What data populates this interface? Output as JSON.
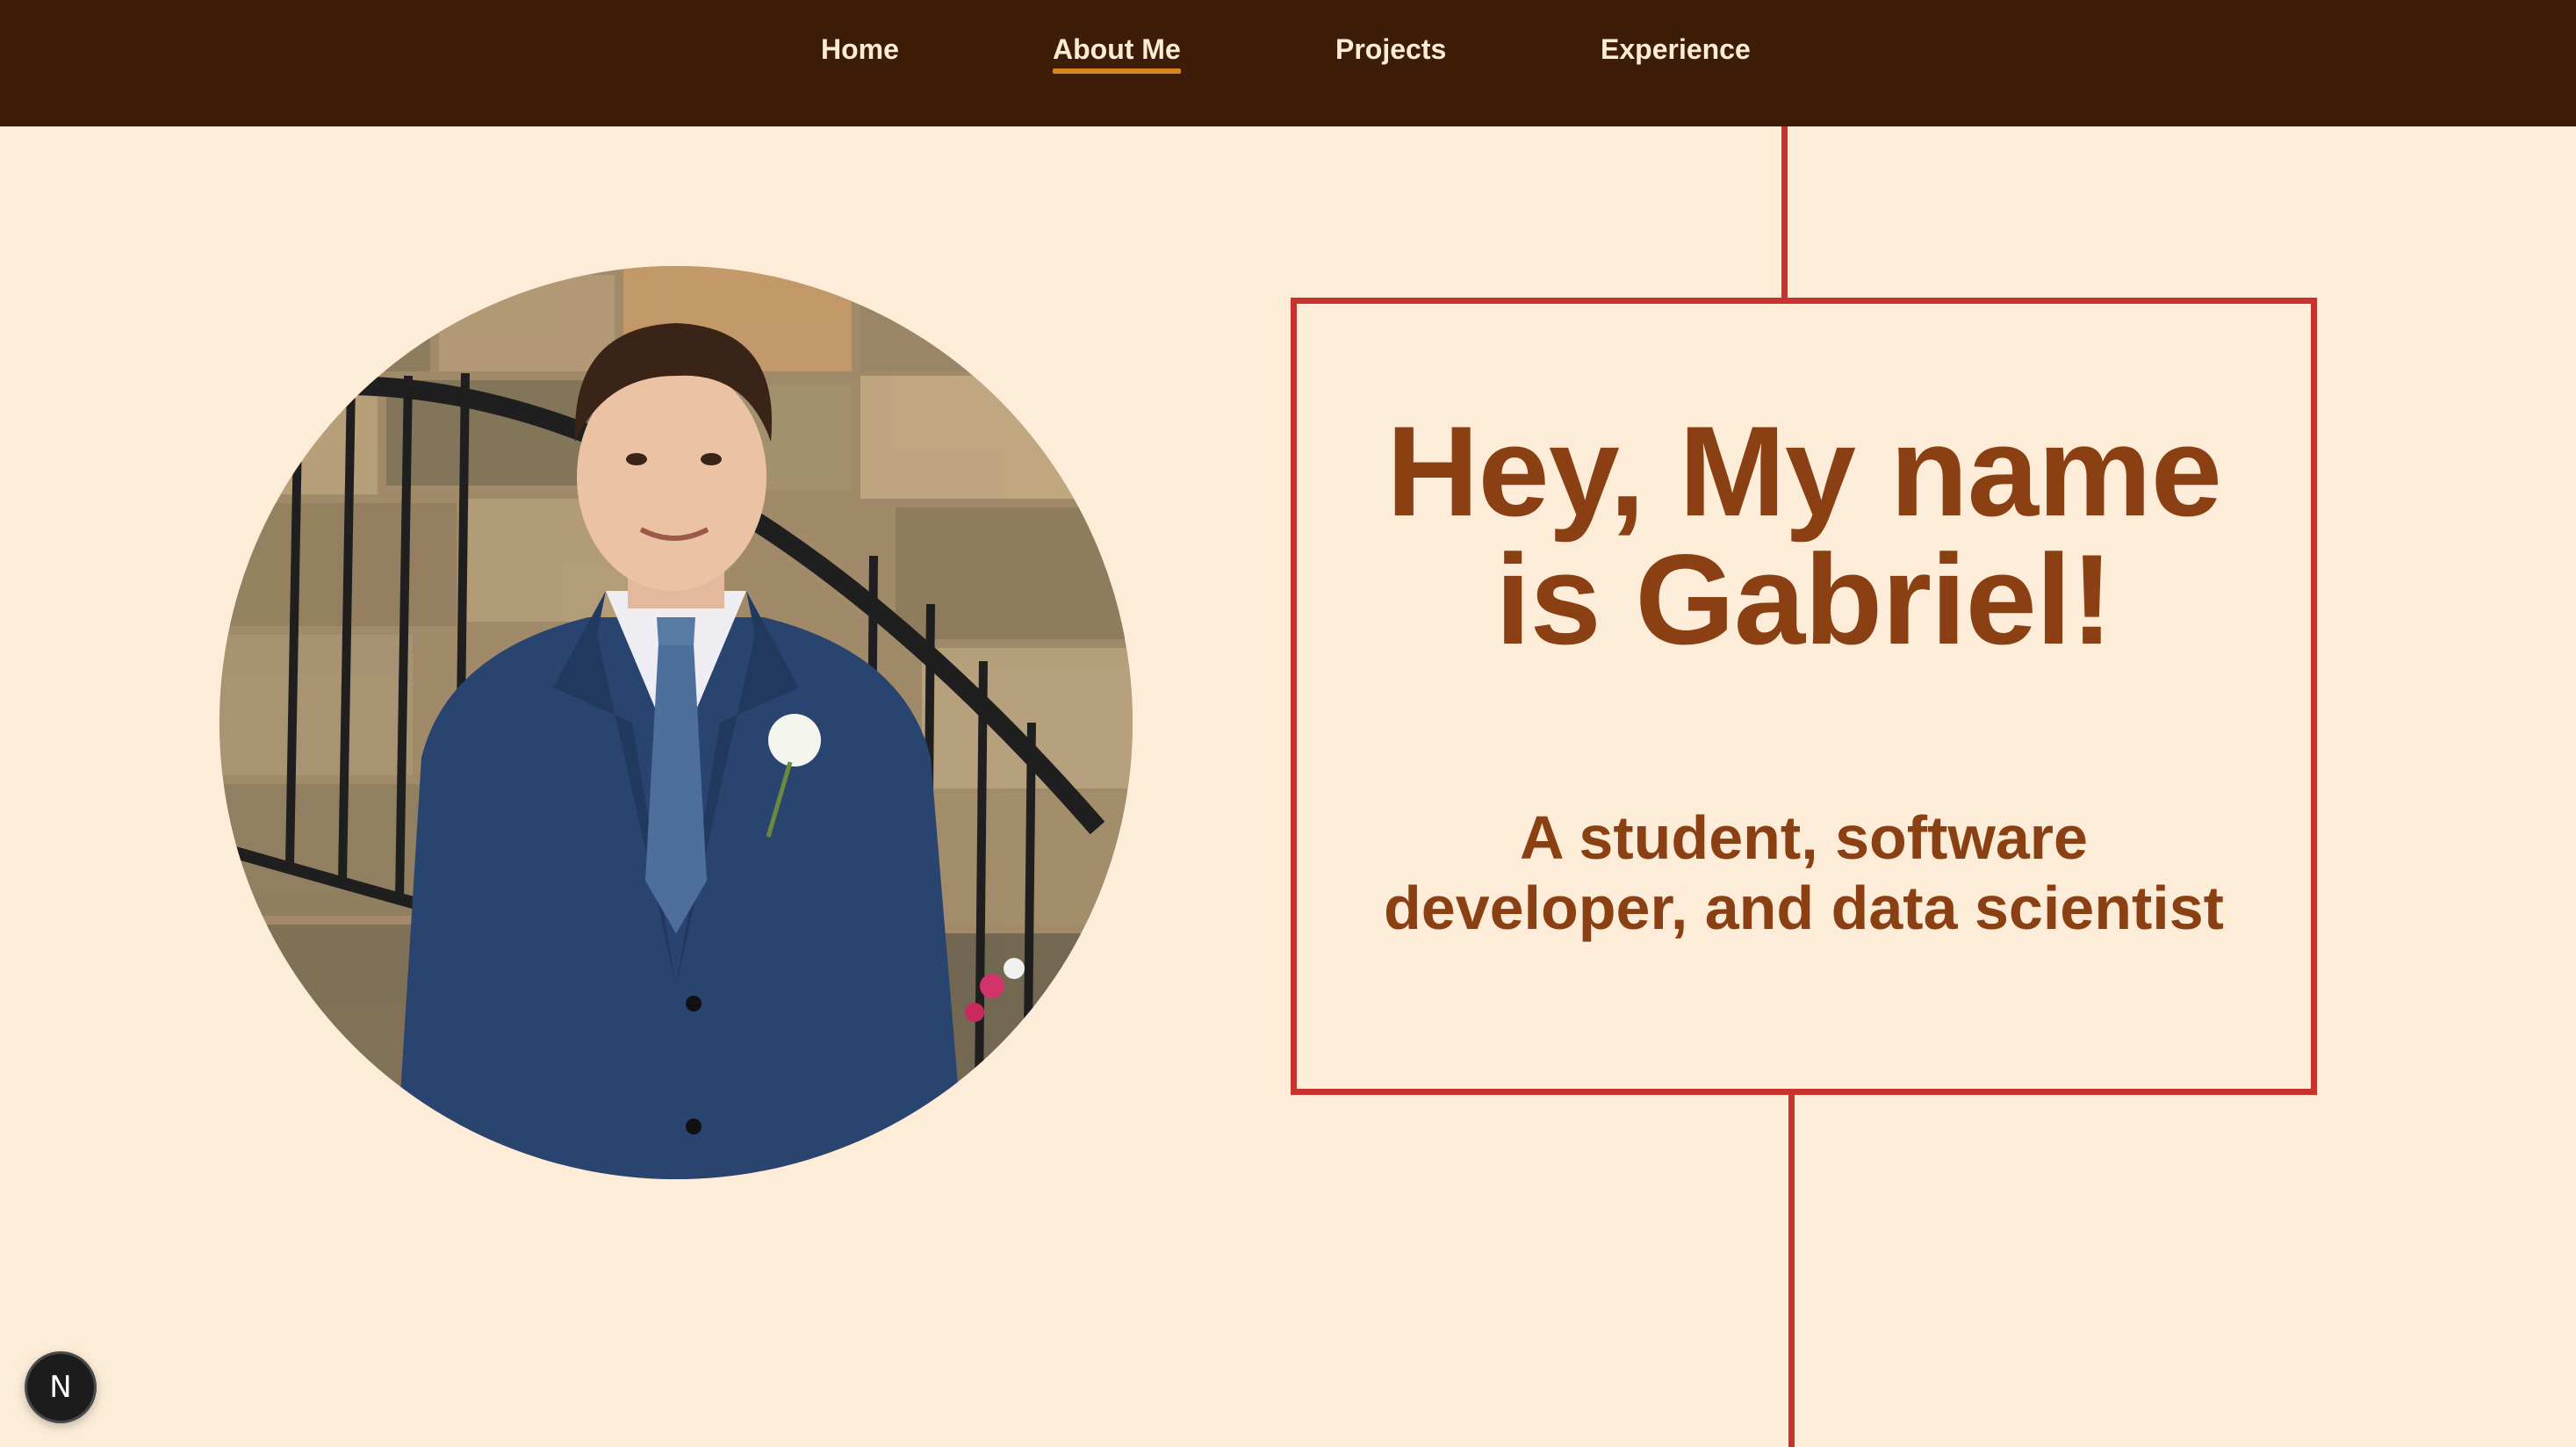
{
  "nav": {
    "items": [
      {
        "label": "Home"
      },
      {
        "label": "About Me",
        "active": true
      },
      {
        "label": "Projects"
      },
      {
        "label": "Experience"
      }
    ]
  },
  "hero": {
    "headline_line1": "Hey, My name",
    "headline_line2": "is Gabriel!",
    "subtitle_line1": "A student, software",
    "subtitle_line2": "developer, and data scientist"
  },
  "dev_badge": {
    "letter": "N",
    "icon": "nextjs-icon"
  },
  "colors": {
    "nav_background": "#3d1d08",
    "nav_text": "#fcecd8",
    "nav_active_underline": "#d9861f",
    "page_background": "#fcecd8",
    "heading_text": "#8b4014",
    "accent_line": "#c8332d"
  }
}
